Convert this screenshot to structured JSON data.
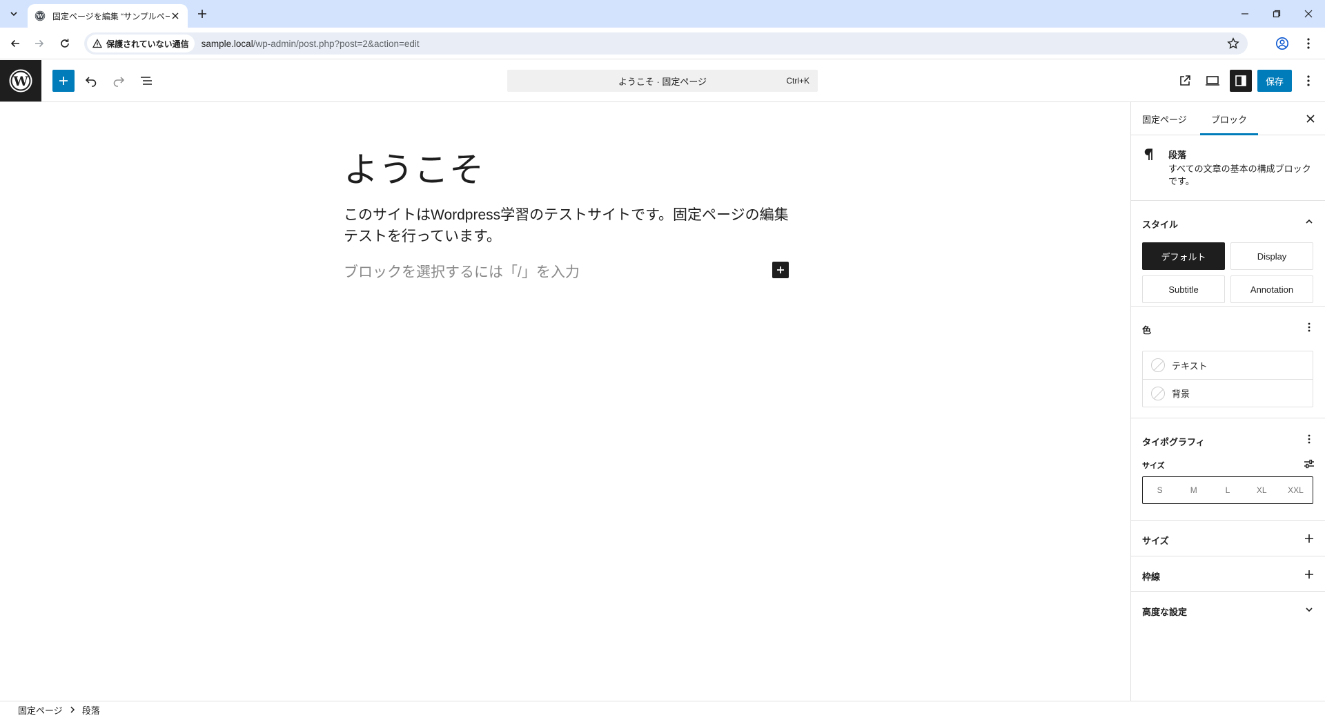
{
  "browser": {
    "tab_title": "固定ページを編集 “サンプルページ”",
    "security_label": "保護されていない通信",
    "url_host": "sample.local",
    "url_path": "/wp-admin/post.php?post=2&action=edit"
  },
  "editor": {
    "command_bar": "ようこそ · 固定ページ",
    "command_shortcut": "Ctrl+K",
    "save_label": "保存"
  },
  "canvas": {
    "title": "ようこそ",
    "paragraph": "このサイトはWordpress学習のテストサイトです。固定ページの編集テストを行っています。",
    "placeholder": "ブロックを選択するには「/」を入力"
  },
  "sidebar": {
    "tabs": [
      {
        "label": "固定ページ"
      },
      {
        "label": "ブロック"
      }
    ],
    "block_card": {
      "title": "段落",
      "description": "すべての文章の基本の構成ブロックです。"
    },
    "styles": {
      "title": "スタイル",
      "options": [
        "デフォルト",
        "Display",
        "Subtitle",
        "Annotation"
      ]
    },
    "color": {
      "title": "色",
      "items": [
        "テキスト",
        "背景"
      ]
    },
    "typography": {
      "title": "タイポグラフィ",
      "size_label": "サイズ",
      "sizes": [
        "S",
        "M",
        "L",
        "XL",
        "XXL"
      ]
    },
    "dimensions_title": "サイズ",
    "border_title": "枠線",
    "advanced_title": "高度な設定"
  },
  "breadcrumb": {
    "root": "固定ページ",
    "current": "段落"
  },
  "colors": {
    "accent": "#007cba",
    "dark": "#1e1e1e",
    "chrome_tabbar": "#d3e3fd"
  }
}
